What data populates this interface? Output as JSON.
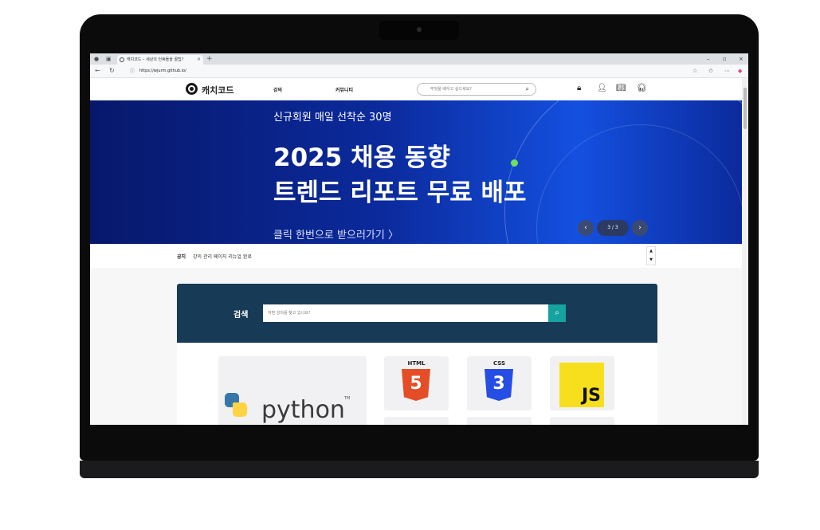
{
  "browser": {
    "tab_title": "캐치코드 – 세상의 언휴들을 꿀팁?",
    "tab_close": "×",
    "new_tab": "+",
    "url": "https://wjurm.github.io/",
    "window_minimize": "–",
    "window_restore": "▫",
    "window_close": "×"
  },
  "header": {
    "logo_text": "캐치코드",
    "nav": [
      "강의",
      "커뮤니티"
    ],
    "search_placeholder": "무엇을 배우고 싶으세요?"
  },
  "banner": {
    "kicker": "신규회원 매일 선착순 30명",
    "title_line1": "2025 채용 동향",
    "title_line2": "트렌드 리포트 무료 배포",
    "cta": "클릭 한번으로 받으러가기 〉",
    "slide_counter": "3 / 3",
    "prev": "‹",
    "next": "›"
  },
  "notice": {
    "label": "공지",
    "text": "강의 관리 페이지 리뉴얼 완료",
    "up": "▲",
    "down": "▼"
  },
  "search_panel": {
    "label": "검색",
    "placeholder": "어떤 강의를 찾고 있나요?"
  },
  "courses": {
    "python": "python",
    "python_tm": "TM",
    "html": "HTML",
    "html_digit": "5",
    "css": "CSS",
    "css_digit": "3",
    "js": "JS"
  },
  "colors": {
    "banner_dark": "#07186b",
    "banner_light": "#1450e0",
    "search_panel": "#173a56",
    "search_button": "#16a3a0",
    "html_orange": "#e44d26",
    "css_blue": "#264de4",
    "js_yellow": "#f7df1e"
  }
}
